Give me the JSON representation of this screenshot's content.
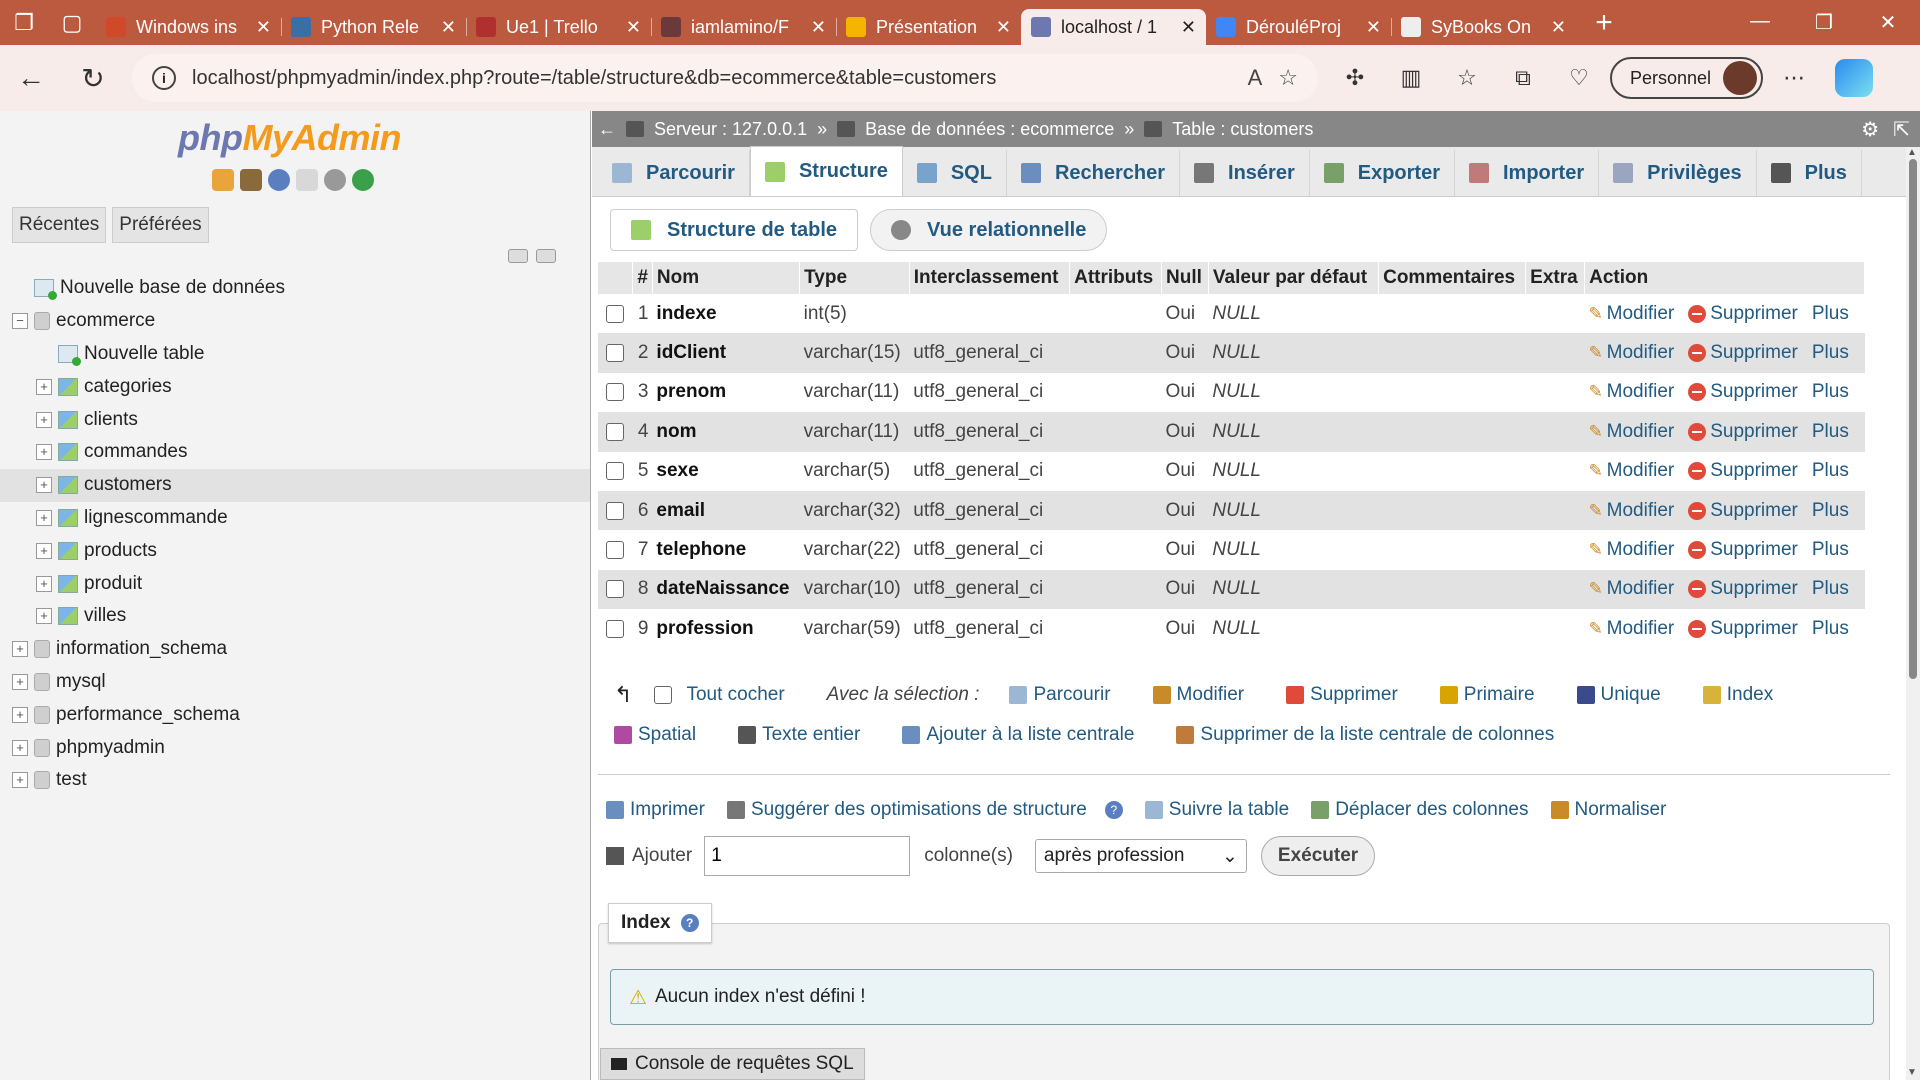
{
  "browser": {
    "tabs": [
      {
        "title": "Windows ins",
        "color": "#d04a2a"
      },
      {
        "title": "Python Rele",
        "color": "#3b6ea5"
      },
      {
        "title": "Ue1 | Trello",
        "color": "#b03030"
      },
      {
        "title": "iamlamino/F",
        "color": "#6a3a3a"
      },
      {
        "title": "Présentation",
        "color": "#f4b400"
      },
      {
        "title": "localhost / 1",
        "color": "#6c78af",
        "active": true
      },
      {
        "title": "DérouléProj",
        "color": "#4285f4"
      },
      {
        "title": "SyBooks On",
        "color": "#eeeeee"
      }
    ],
    "url": "localhost/phpmyadmin/index.php?route=/table/structure&db=ecommerce&table=customers",
    "profile_label": "Personnel"
  },
  "pma": {
    "logo_php": "php",
    "logo_my": "MyAdmin",
    "left_tabs": [
      "Récentes",
      "Préférées"
    ],
    "tree": [
      {
        "label": "Nouvelle base de données",
        "level": 0,
        "kind": "new"
      },
      {
        "label": "ecommerce",
        "level": 0,
        "kind": "db",
        "expanded": true
      },
      {
        "label": "Nouvelle table",
        "level": 1,
        "kind": "new"
      },
      {
        "label": "categories",
        "level": 1,
        "kind": "table"
      },
      {
        "label": "clients",
        "level": 1,
        "kind": "table"
      },
      {
        "label": "commandes",
        "level": 1,
        "kind": "table"
      },
      {
        "label": "customers",
        "level": 1,
        "kind": "table",
        "selected": true
      },
      {
        "label": "lignescommande",
        "level": 1,
        "kind": "table"
      },
      {
        "label": "products",
        "level": 1,
        "kind": "table"
      },
      {
        "label": "produit",
        "level": 1,
        "kind": "table"
      },
      {
        "label": "villes",
        "level": 1,
        "kind": "table"
      },
      {
        "label": "information_schema",
        "level": 0,
        "kind": "db"
      },
      {
        "label": "mysql",
        "level": 0,
        "kind": "db"
      },
      {
        "label": "performance_schema",
        "level": 0,
        "kind": "db"
      },
      {
        "label": "phpmyadmin",
        "level": 0,
        "kind": "db"
      },
      {
        "label": "test",
        "level": 0,
        "kind": "db"
      }
    ],
    "breadcrumb": {
      "server": "Serveur : 127.0.0.1",
      "database": "Base de données : ecommerce",
      "table": "Table : customers"
    },
    "main_tabs": [
      "Parcourir",
      "Structure",
      "SQL",
      "Rechercher",
      "Insérer",
      "Exporter",
      "Importer",
      "Privilèges",
      "Plus"
    ],
    "active_tab": "Structure",
    "sub_tabs": [
      "Structure de table",
      "Vue relationnelle"
    ],
    "columns_header": [
      "#",
      "Nom",
      "Type",
      "Interclassement",
      "Attributs",
      "Null",
      "Valeur par défaut",
      "Commentaires",
      "Extra",
      "Action"
    ],
    "rows": [
      {
        "n": "1",
        "name": "indexe",
        "type": "int(5)",
        "collation": "",
        "null": "Oui",
        "default": "NULL"
      },
      {
        "n": "2",
        "name": "idClient",
        "type": "varchar(15)",
        "collation": "utf8_general_ci",
        "null": "Oui",
        "default": "NULL"
      },
      {
        "n": "3",
        "name": "prenom",
        "type": "varchar(11)",
        "collation": "utf8_general_ci",
        "null": "Oui",
        "default": "NULL"
      },
      {
        "n": "4",
        "name": "nom",
        "type": "varchar(11)",
        "collation": "utf8_general_ci",
        "null": "Oui",
        "default": "NULL"
      },
      {
        "n": "5",
        "name": "sexe",
        "type": "varchar(5)",
        "collation": "utf8_general_ci",
        "null": "Oui",
        "default": "NULL"
      },
      {
        "n": "6",
        "name": "email",
        "type": "varchar(32)",
        "collation": "utf8_general_ci",
        "null": "Oui",
        "default": "NULL"
      },
      {
        "n": "7",
        "name": "telephone",
        "type": "varchar(22)",
        "collation": "utf8_general_ci",
        "null": "Oui",
        "default": "NULL"
      },
      {
        "n": "8",
        "name": "dateNaissance",
        "type": "varchar(10)",
        "collation": "utf8_general_ci",
        "null": "Oui",
        "default": "NULL"
      },
      {
        "n": "9",
        "name": "profession",
        "type": "varchar(59)",
        "collation": "utf8_general_ci",
        "null": "Oui",
        "default": "NULL"
      }
    ],
    "row_actions": {
      "modify": "Modifier",
      "delete": "Supprimer",
      "more": "Plus"
    },
    "selection": {
      "check_all": "Tout cocher",
      "with_selection": "Avec la sélection :",
      "actions_row1": [
        "Parcourir",
        "Modifier",
        "Supprimer",
        "Primaire",
        "Unique",
        "Index"
      ],
      "actions_row2": [
        "Spatial",
        "Texte entier",
        "Ajouter à la liste centrale",
        "Supprimer de la liste centrale de colonnes"
      ]
    },
    "tools": [
      "Imprimer",
      "Suggérer des optimisations de structure",
      "Suivre la table",
      "Déplacer des colonnes",
      "Normaliser"
    ],
    "add": {
      "label": "Ajouter",
      "count": "1",
      "unit": "colonne(s)",
      "position": "après profession",
      "submit": "Exécuter"
    },
    "index": {
      "title": "Index",
      "notice": "Aucun index n'est défini !"
    },
    "console": "Console de requêtes SQL"
  }
}
